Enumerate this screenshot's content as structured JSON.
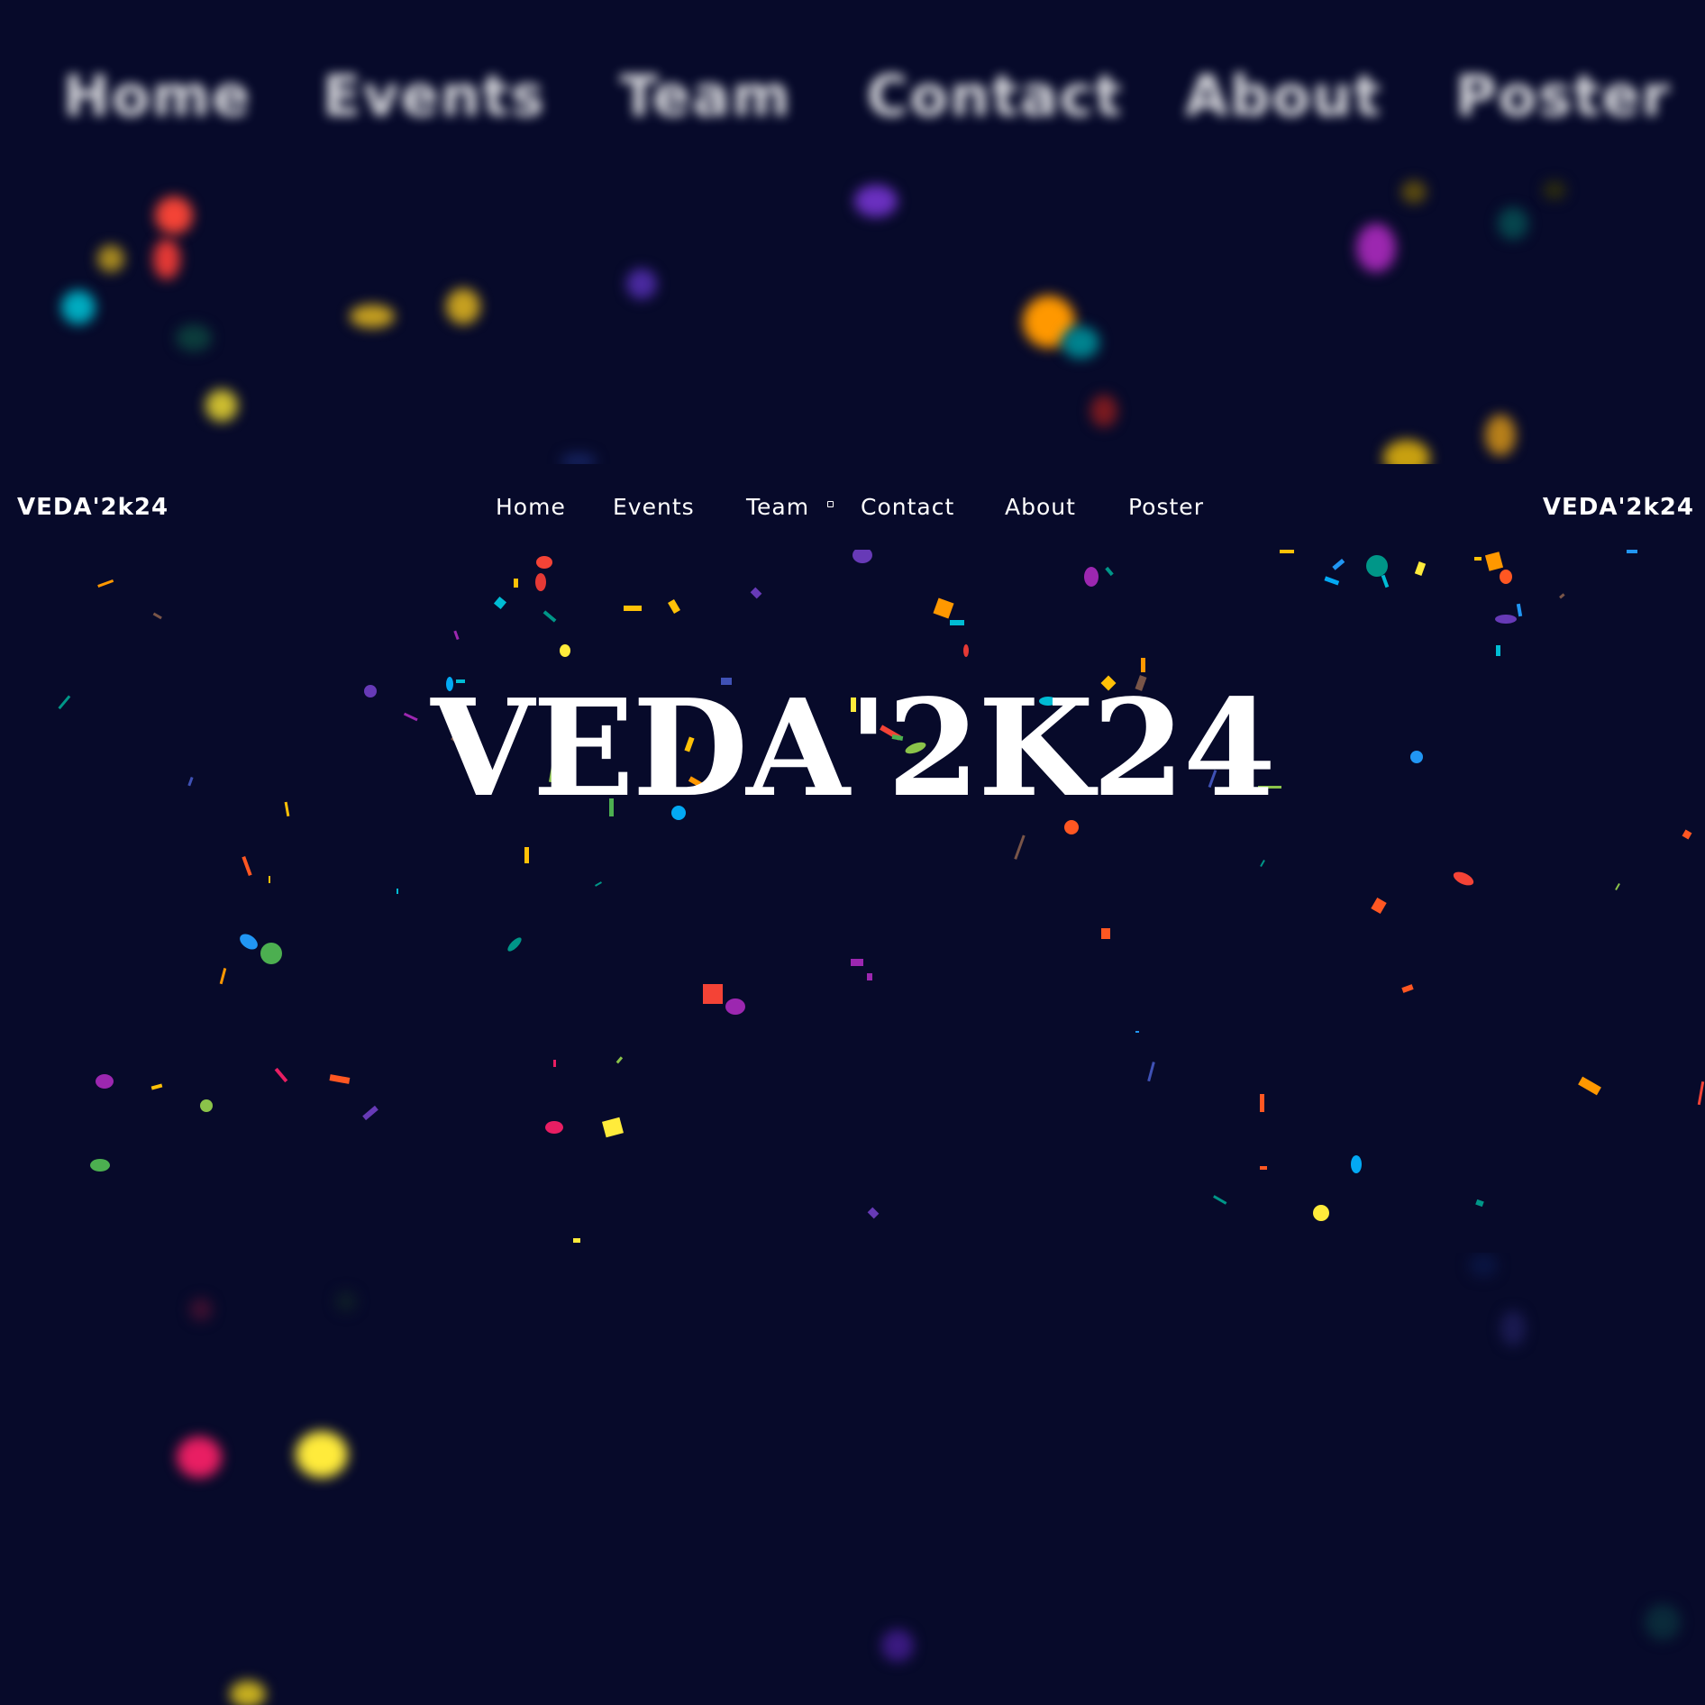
{
  "header": {
    "brand_left": "VEDA'2k24",
    "brand_right": "VEDA'2k24",
    "nav": [
      "Home",
      "Events",
      "Team",
      "Contact",
      "About",
      "Poster"
    ]
  },
  "hero": {
    "title": "VEDA'2K24"
  },
  "colors": {
    "background": "#070a2a",
    "text": "#ffffff",
    "confetti": [
      "#f44336",
      "#ffc107",
      "#00bcd4",
      "#9c27b0",
      "#4caf50",
      "#ff5722",
      "#2196f3",
      "#e91e63",
      "#673ab7",
      "#ffeb3b",
      "#8bc34a",
      "#ff9800",
      "#795548",
      "#009688",
      "#3f51b5",
      "#03a9f4"
    ]
  }
}
